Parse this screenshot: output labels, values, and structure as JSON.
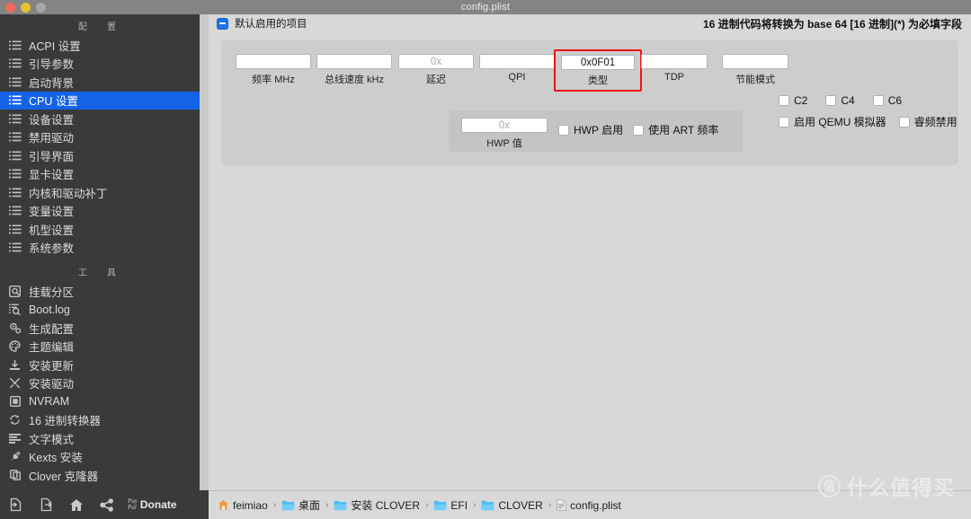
{
  "window": {
    "title": "config.plist",
    "traffic_lights": [
      "close-red",
      "minimize-yellow",
      "zoom-gray"
    ]
  },
  "sidebar": {
    "config_section_title": "配　置",
    "config_items": [
      {
        "icon": "list-icon",
        "label": "ACPI 设置",
        "selected": false
      },
      {
        "icon": "list-icon",
        "label": "引导参数",
        "selected": false
      },
      {
        "icon": "list-icon",
        "label": "启动背景",
        "selected": false
      },
      {
        "icon": "list-icon",
        "label": "CPU 设置",
        "selected": true
      },
      {
        "icon": "list-icon",
        "label": "设备设置",
        "selected": false
      },
      {
        "icon": "list-icon",
        "label": "禁用驱动",
        "selected": false
      },
      {
        "icon": "list-icon",
        "label": "引导界面",
        "selected": false
      },
      {
        "icon": "list-icon",
        "label": "显卡设置",
        "selected": false
      },
      {
        "icon": "list-icon",
        "label": "内核和驱动补丁",
        "selected": false
      },
      {
        "icon": "list-icon",
        "label": "变量设置",
        "selected": false
      },
      {
        "icon": "list-icon",
        "label": "机型设置",
        "selected": false
      },
      {
        "icon": "list-icon",
        "label": "系统参数",
        "selected": false
      }
    ],
    "tools_section_title": "工　具",
    "tool_items": [
      {
        "icon": "disk-mount-icon",
        "label": "挂载分区"
      },
      {
        "icon": "log-search-icon",
        "label": "Boot.log"
      },
      {
        "icon": "gears-icon",
        "label": "生成配置"
      },
      {
        "icon": "palette-icon",
        "label": "主题编辑"
      },
      {
        "icon": "download-icon",
        "label": "安装更新"
      },
      {
        "icon": "tools-icon",
        "label": "安装驱动"
      },
      {
        "icon": "chip-icon",
        "label": "NVRAM"
      },
      {
        "icon": "refresh-icon",
        "label": "16 进制转换器"
      },
      {
        "icon": "text-lines-icon",
        "label": "文字模式"
      },
      {
        "icon": "plug-icon",
        "label": "Kexts 安装"
      },
      {
        "icon": "copy-icon",
        "label": "Clover 克隆器"
      }
    ]
  },
  "dock": {
    "buttons": [
      {
        "icon": "import-file-icon",
        "label": ""
      },
      {
        "icon": "export-file-icon",
        "label": ""
      },
      {
        "icon": "home-icon",
        "label": ""
      },
      {
        "icon": "share-icon",
        "label": ""
      }
    ],
    "paypal_line1": "Pay",
    "paypal_line2": "Pal",
    "donate_label": "Donate"
  },
  "content": {
    "header_checkbox_state": "indeterminate",
    "header_label": "默认启用的项目",
    "header_note": "16 进制代码将转换为 base 64 [16 进制](*) 为必填字段",
    "fields": [
      {
        "name": "frequency-mhz",
        "label": "频率 MHz",
        "value": "",
        "placeholder": "",
        "highlighted": false
      },
      {
        "name": "bus-speed-khz",
        "label": "总线速度 kHz",
        "value": "",
        "placeholder": "",
        "highlighted": false
      },
      {
        "name": "latency",
        "label": "延迟",
        "value": "",
        "placeholder": "0x",
        "highlighted": false
      },
      {
        "name": "qpi",
        "label": "QPI",
        "value": "",
        "placeholder": "",
        "highlighted": false
      },
      {
        "name": "type",
        "label": "类型",
        "value": "0x0F01",
        "placeholder": "",
        "highlighted": true
      },
      {
        "name": "tdp",
        "label": "TDP",
        "value": "",
        "placeholder": "",
        "highlighted": false
      },
      {
        "name": "power-saving-mode",
        "label": "节能模式",
        "value": "",
        "placeholder": "",
        "highlighted": false
      }
    ],
    "hwp": {
      "field": {
        "name": "hwp-value",
        "label": "HWP 值",
        "value": "",
        "placeholder": "0x"
      },
      "checkboxes": [
        {
          "name": "hwp-enable",
          "label": "HWP 启用",
          "checked": false
        },
        {
          "name": "use-art-frequency",
          "label": "使用 ART 频率",
          "checked": false
        }
      ]
    },
    "cstate_checkboxes": [
      {
        "name": "c2",
        "label": "C2",
        "checked": false
      },
      {
        "name": "c4",
        "label": "C4",
        "checked": false
      },
      {
        "name": "c6",
        "label": "C6",
        "checked": false
      }
    ],
    "extra_checkboxes": [
      {
        "name": "enable-qemu-emulator",
        "label": "启用 QEMU 模拟器",
        "checked": false
      },
      {
        "name": "turbo-disable",
        "label": "睿频禁用",
        "checked": false
      }
    ]
  },
  "breadcrumb": {
    "separator": "›",
    "items": [
      {
        "icon": "home-folder-icon",
        "label": "feimiao"
      },
      {
        "icon": "folder-icon",
        "label": "桌面"
      },
      {
        "icon": "folder-icon",
        "label": "安装 CLOVER"
      },
      {
        "icon": "folder-icon",
        "label": "EFI"
      },
      {
        "icon": "folder-icon",
        "label": "CLOVER"
      },
      {
        "icon": "plist-file-icon",
        "label": "config.plist"
      }
    ]
  },
  "watermark": {
    "badge": "值",
    "text": "什么值得买"
  },
  "colors": {
    "accent_blue": "#1463e6",
    "highlight_red": "#ee1111",
    "sidebar_bg": "#3a3a3a",
    "content_bg": "#d8d8d8",
    "panel_bg": "#cdcdcd"
  }
}
